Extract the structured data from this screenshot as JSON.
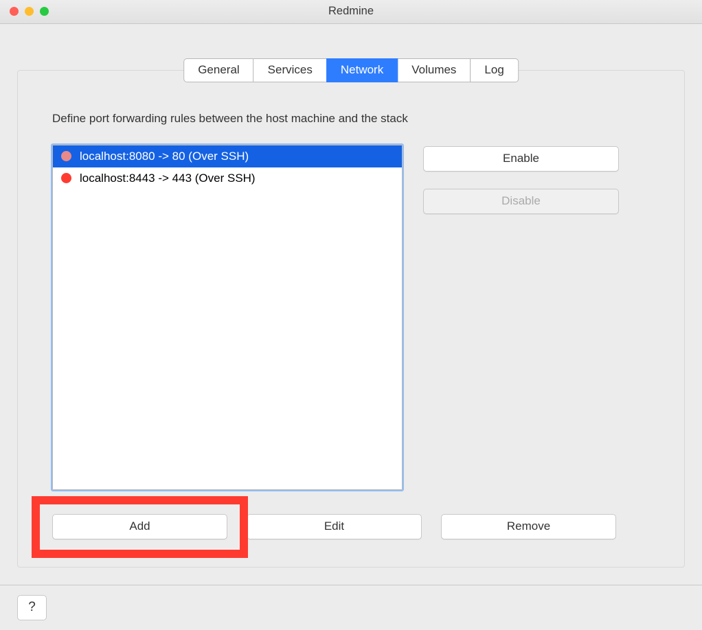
{
  "window": {
    "title": "Redmine"
  },
  "tabs": [
    {
      "label": "General",
      "active": false
    },
    {
      "label": "Services",
      "active": false
    },
    {
      "label": "Network",
      "active": true
    },
    {
      "label": "Volumes",
      "active": false
    },
    {
      "label": "Log",
      "active": false
    }
  ],
  "network": {
    "description": "Define port forwarding rules between the host machine and the stack",
    "rules": [
      {
        "text": "localhost:8080 -> 80 (Over SSH)",
        "selected": true
      },
      {
        "text": "localhost:8443 -> 443 (Over SSH)",
        "selected": false
      }
    ],
    "buttons": {
      "enable": "Enable",
      "disable": "Disable",
      "add": "Add",
      "edit": "Edit",
      "remove": "Remove"
    }
  },
  "footer": {
    "help": "?"
  }
}
